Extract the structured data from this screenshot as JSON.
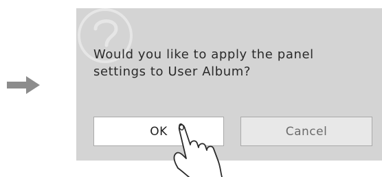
{
  "dialog": {
    "message_line1": "Would you like to apply the panel",
    "message_line2": "settings to User Album?",
    "ok_label": "OK",
    "cancel_label": "Cancel"
  },
  "icons": {
    "arrow": "arrow-right-icon",
    "watermark": "question-mark-icon",
    "hand": "pointing-hand-icon"
  },
  "colors": {
    "dialog_background": "#d4d4d4",
    "ok_background": "#ffffff",
    "cancel_background": "#e8e8e8",
    "arrow": "#8c8c8c",
    "text": "#2a2a2a"
  }
}
